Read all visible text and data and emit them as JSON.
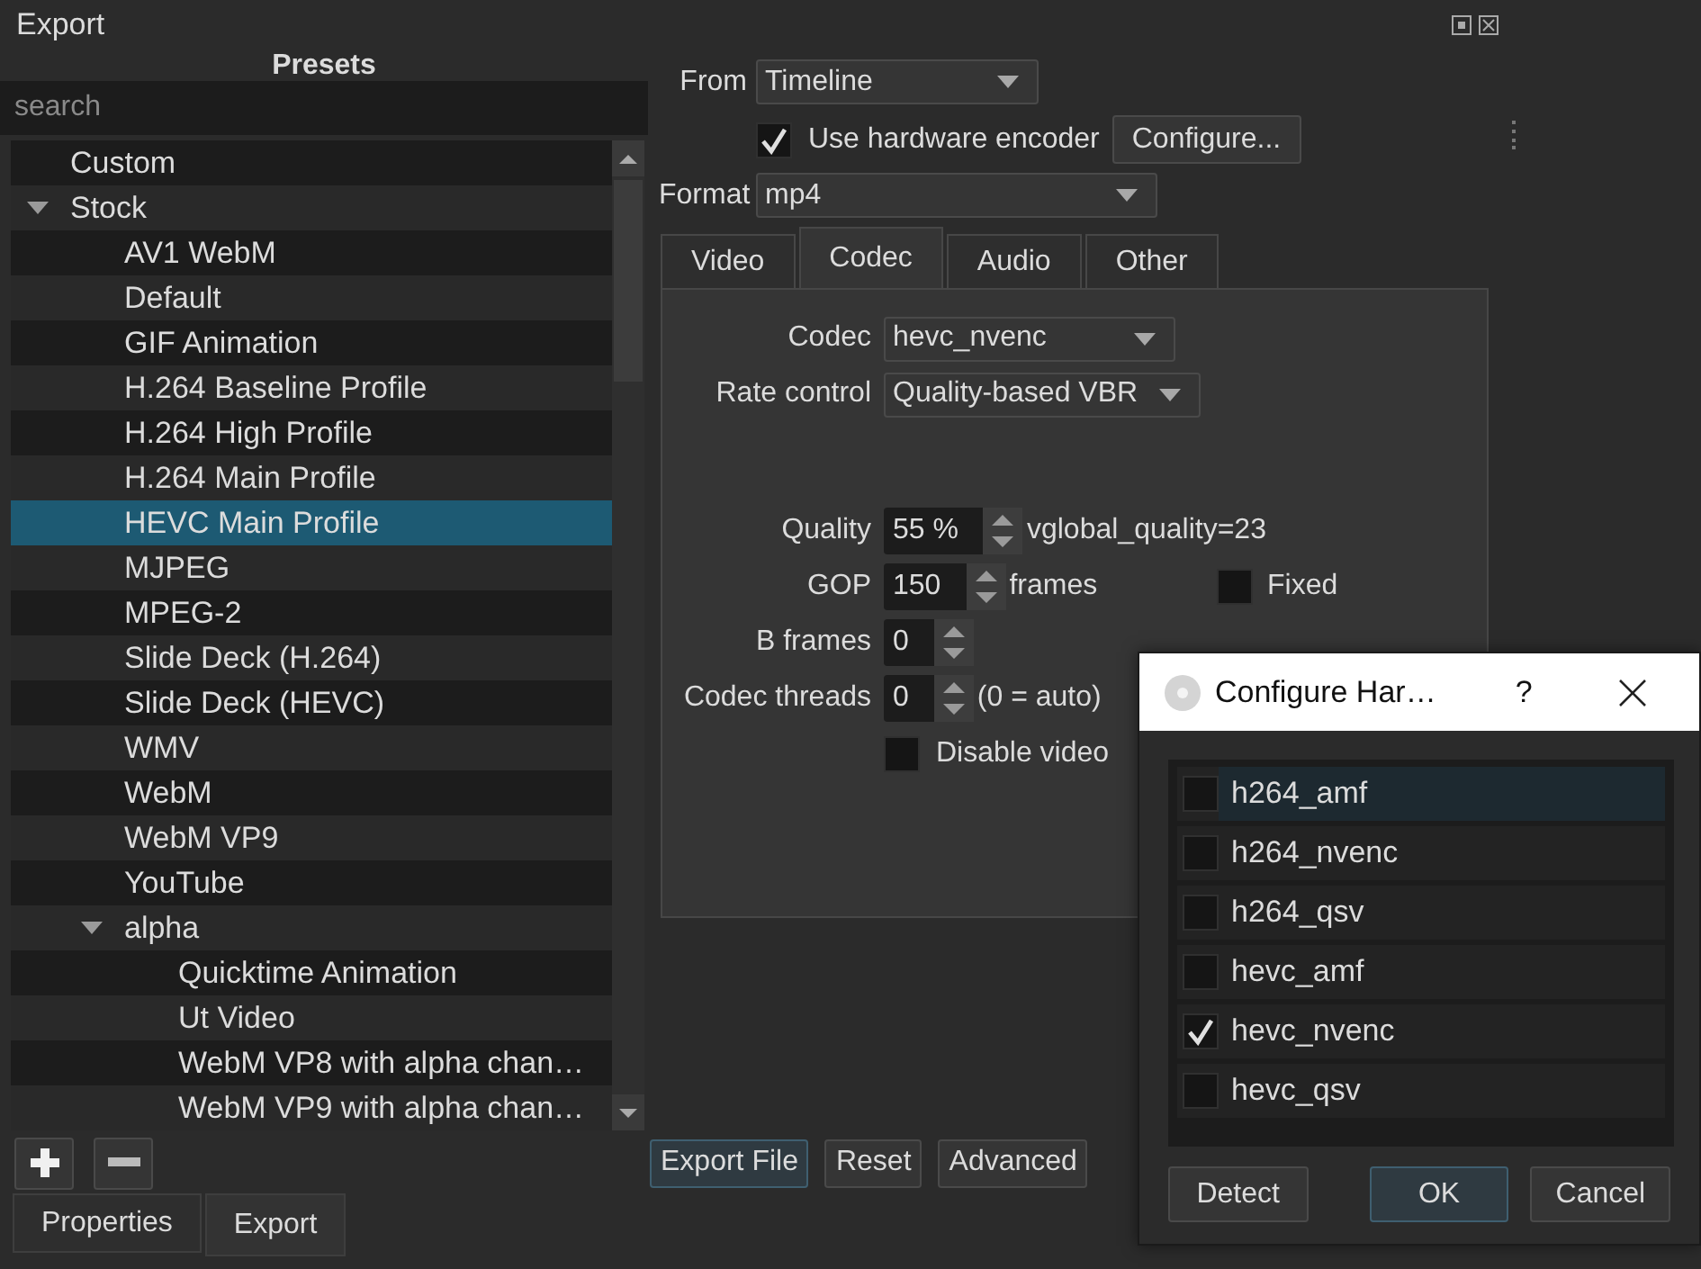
{
  "window": {
    "title": "Export"
  },
  "presets": {
    "title": "Presets",
    "search": {
      "placeholder": "search"
    },
    "tree": [
      {
        "label": "Custom",
        "selected": false
      },
      {
        "label": "Stock",
        "selected": false,
        "expanded": true,
        "children": [
          {
            "label": "AV1 WebM",
            "selected": false
          },
          {
            "label": "Default",
            "selected": false
          },
          {
            "label": "GIF Animation",
            "selected": false
          },
          {
            "label": "H.264 Baseline Profile",
            "selected": false
          },
          {
            "label": "H.264 High Profile",
            "selected": false
          },
          {
            "label": "H.264 Main Profile",
            "selected": false
          },
          {
            "label": "HEVC Main Profile",
            "selected": true
          },
          {
            "label": "MJPEG",
            "selected": false
          },
          {
            "label": "MPEG-2",
            "selected": false
          },
          {
            "label": "Slide Deck (H.264)",
            "selected": false
          },
          {
            "label": "Slide Deck (HEVC)",
            "selected": false
          },
          {
            "label": "WMV",
            "selected": false
          },
          {
            "label": "WebM",
            "selected": false
          },
          {
            "label": "WebM VP9",
            "selected": false
          },
          {
            "label": "YouTube",
            "selected": false
          },
          {
            "label": "alpha",
            "selected": false,
            "expanded": true,
            "children": [
              {
                "label": "Quicktime Animation",
                "selected": false
              },
              {
                "label": "Ut Video",
                "selected": false
              },
              {
                "label": "WebM VP8 with alpha chan…",
                "selected": false
              },
              {
                "label": "WebM VP9 with alpha chan…",
                "selected": false
              }
            ]
          }
        ]
      }
    ]
  },
  "form": {
    "from": {
      "label": "From",
      "value": "Timeline"
    },
    "hardware_encoder": {
      "label": "Use hardware encoder",
      "checked": true,
      "button": "Configure..."
    },
    "format": {
      "label": "Format",
      "value": "mp4"
    },
    "tabs": [
      {
        "label": "Video",
        "selected": false
      },
      {
        "label": "Codec",
        "selected": true
      },
      {
        "label": "Audio",
        "selected": false
      },
      {
        "label": "Other",
        "selected": false
      }
    ],
    "codec_fields": [
      {
        "kind": "combo",
        "label": "Codec",
        "value": "hevc_nvenc"
      },
      {
        "kind": "combo",
        "label": "Rate control",
        "value": "Quality-based VBR"
      },
      {
        "kind": "spin",
        "label": "Quality",
        "value": "55 %",
        "note": "vglobal_quality=23"
      },
      {
        "kind": "spin",
        "label": "GOP",
        "value": "150",
        "note": "frames",
        "option": {
          "label": "Fixed",
          "checked": false
        }
      },
      {
        "kind": "spin",
        "label": "B frames",
        "value": "0"
      },
      {
        "kind": "spin",
        "label": "Codec threads",
        "value": "0",
        "note": "(0 = auto)"
      },
      {
        "kind": "check",
        "label": "Disable video",
        "checked": false
      }
    ]
  },
  "buttons": [
    {
      "label": "Export File",
      "focused": true
    },
    {
      "label": "Reset",
      "focused": false
    },
    {
      "label": "Advanced",
      "focused": false
    }
  ],
  "bottom_tabs": [
    {
      "label": "Properties",
      "selected": false
    },
    {
      "label": "Export",
      "selected": true
    }
  ],
  "dialog": {
    "title": "Configure Har…",
    "help": "?",
    "encoders": [
      {
        "label": "h264_amf",
        "checked": false,
        "selected": true
      },
      {
        "label": "h264_nvenc",
        "checked": false,
        "selected": false
      },
      {
        "label": "h264_qsv",
        "checked": false,
        "selected": false
      },
      {
        "label": "hevc_amf",
        "checked": false,
        "selected": false
      },
      {
        "label": "hevc_nvenc",
        "checked": true,
        "selected": false
      },
      {
        "label": "hevc_qsv",
        "checked": false,
        "selected": false
      }
    ],
    "buttons": [
      {
        "label": "Detect",
        "default": false
      },
      {
        "label": "OK",
        "default": true
      },
      {
        "label": "Cancel",
        "default": false
      }
    ]
  }
}
